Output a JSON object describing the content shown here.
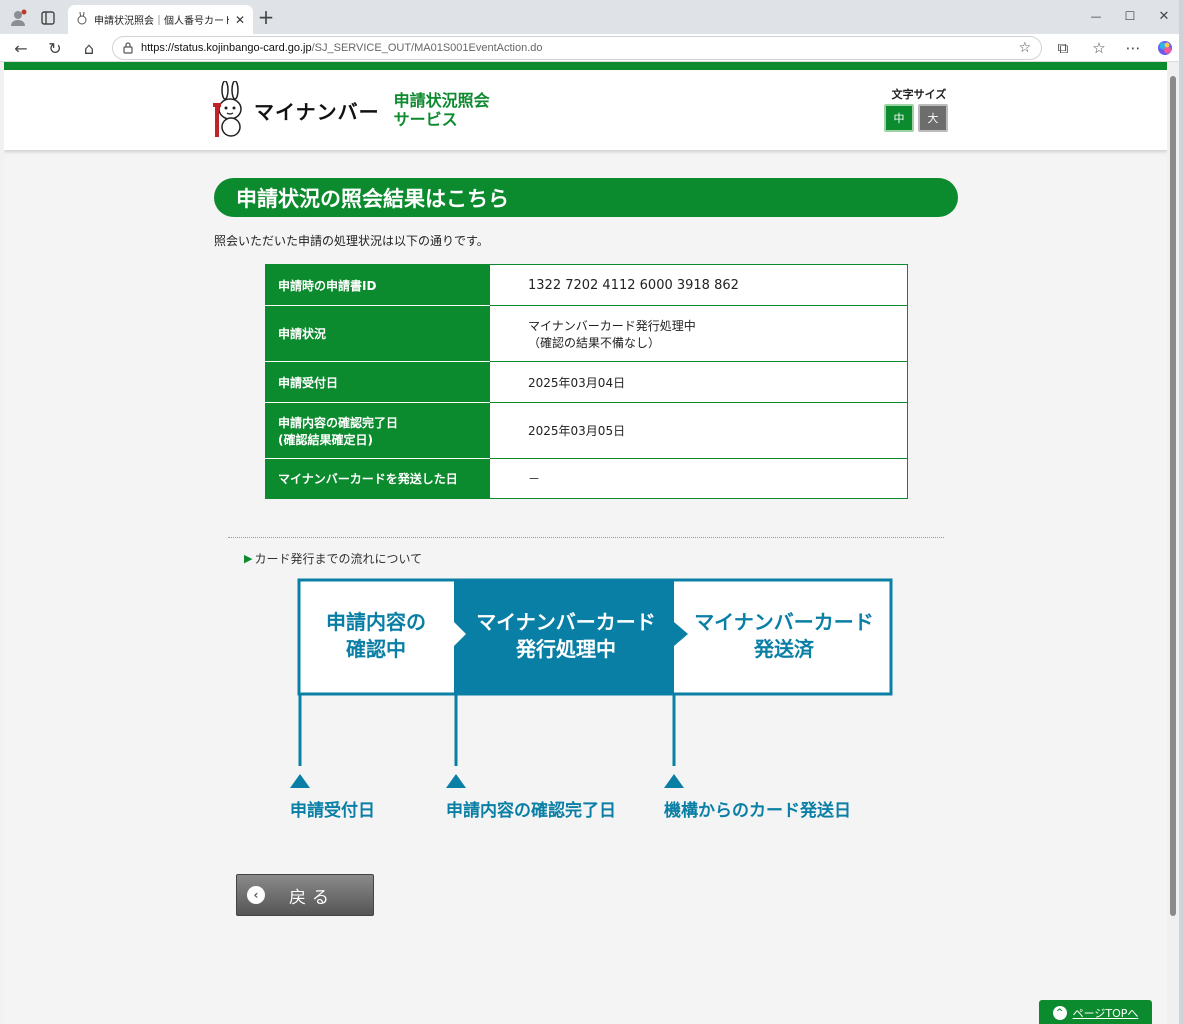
{
  "browser": {
    "tab_title": "申請状況照会｜個人番号カード交付",
    "tab_close": "✕",
    "new_tab": "+",
    "url_host": "https://status.kojinbango-card.go.jp",
    "url_path": "/SJ_SERVICE_OUT/MA01S001EventAction.do",
    "window_controls": [
      "—",
      "☐",
      "✕"
    ],
    "icons": {
      "back": "←",
      "reload": "↻",
      "home": "⌂",
      "lock": "🔒",
      "favorite": "☆",
      "extensions": "⧉",
      "favorites_bar": "☆",
      "more": "⋯"
    }
  },
  "header": {
    "logo_text": "マイナンバー",
    "service_line1": "申請状況照会",
    "service_line2": "サービス",
    "fontsize_label": "文字サイズ",
    "fontsize_mid": "中",
    "fontsize_large": "大"
  },
  "main": {
    "title": "申請状況の照会結果はこちら",
    "intro": "照会いただいた申請の処理状況は以下の通りです。",
    "table": [
      {
        "label": "申請時の申請書ID",
        "value": "1322 7202 4112 6000 3918 862"
      },
      {
        "label": "申請状況",
        "value_line1": "マイナンバーカード発行処理中",
        "value_line2": "（確認の結果不備なし）"
      },
      {
        "label": "申請受付日",
        "value": "2025年03月04日"
      },
      {
        "label_line1": "申請内容の確認完了日",
        "label_line2": "(確認結果確定日)",
        "value": "2025年03月05日"
      },
      {
        "label": "マイナンバーカードを発送した日",
        "value": "－"
      }
    ],
    "flow_link_marker": "▶",
    "flow_link": "カード発行までの流れについて",
    "flow": {
      "steps": [
        {
          "line1": "申請内容の",
          "line2": "確認中"
        },
        {
          "line1": "マイナンバーカード",
          "line2": "発行処理中"
        },
        {
          "line1": "マイナンバーカード",
          "line2": "発送済"
        }
      ],
      "active_step": 2,
      "milestones": [
        "申請受付日",
        "申請内容の確認完了日",
        "機構からのカード発送日"
      ],
      "color": "#0a7fa6"
    },
    "back_icon": "‹",
    "back_label": "戻る"
  },
  "footer": {
    "pagetop_icon": "^",
    "pagetop_label": "ページTOPへ"
  },
  "colors": {
    "brand_green": "#0c8a2e",
    "flow_blue": "#0a7fa6"
  }
}
